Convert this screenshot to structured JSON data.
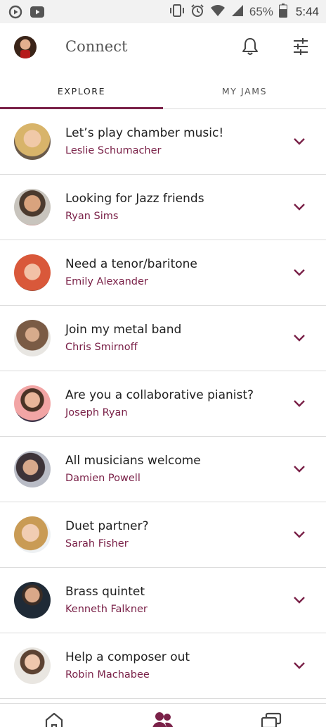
{
  "status_bar": {
    "battery_percent": "65%",
    "time": "5:44",
    "icons": [
      "play-circle-icon",
      "youtube-icon",
      "vibrate-icon",
      "alarm-icon",
      "wifi-icon",
      "signal-icon",
      "battery-icon"
    ]
  },
  "app_bar": {
    "title": "Connect",
    "icons": [
      "profile-avatar",
      "bell-icon",
      "tune-filter-icon"
    ]
  },
  "tabs": [
    {
      "label": "EXPLORE",
      "active": true
    },
    {
      "label": "MY JAMS",
      "active": false
    }
  ],
  "colors": {
    "accent": "#7a2148",
    "divider": "#dcdcdc",
    "status_bar_bg": "#f2f2f2"
  },
  "posts": [
    {
      "title": "Let’s play chamber music!",
      "author": "Leslie Schumacher"
    },
    {
      "title": "Looking for Jazz friends",
      "author": "Ryan Sims"
    },
    {
      "title": "Need a tenor/baritone",
      "author": "Emily Alexander"
    },
    {
      "title": "Join my metal band",
      "author": "Chris Smirnoff"
    },
    {
      "title": "Are you a collaborative pianist?",
      "author": "Joseph Ryan"
    },
    {
      "title": "All musicians welcome",
      "author": "Damien Powell"
    },
    {
      "title": "Duet partner?",
      "author": "Sarah Fisher"
    },
    {
      "title": "Brass quintet",
      "author": "Kenneth Falkner"
    },
    {
      "title": "Help a composer out",
      "author": "Robin Machabee"
    }
  ],
  "bottom_nav": {
    "items": [
      "home-icon",
      "people-icon",
      "chat-icon"
    ],
    "active": "people-icon"
  }
}
